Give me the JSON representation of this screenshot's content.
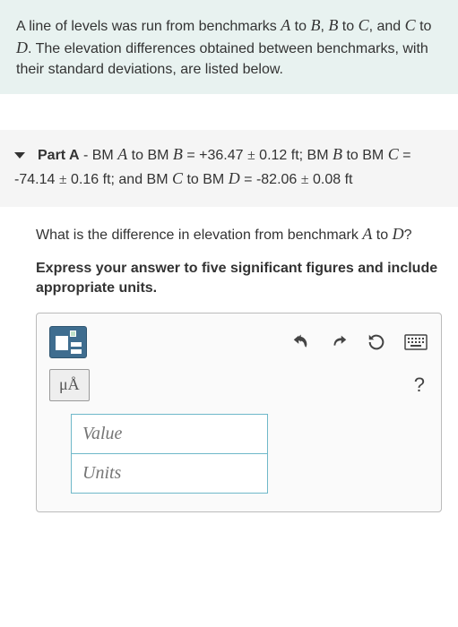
{
  "intro": {
    "text_pre": "A line of levels was run from benchmarks ",
    "A": "A",
    "to1": " to ",
    "B": "B",
    "comma1": ", ",
    "B2": "B",
    "to2": " to ",
    "C": "C",
    "comma2": ", and ",
    "C2": "C",
    "to3": " to ",
    "D": "D",
    "text_post": ". The elevation differences obtained between benchmarks, with their standard deviations, are listed below."
  },
  "part": {
    "label": "Part A",
    "dash": " - ",
    "seg1_pre": "BM ",
    "seg1_A": "A",
    "seg1_mid": " to BM ",
    "seg1_B": "B",
    "seg1_eq": " = +36.47 ",
    "pm": "±",
    "seg1_err": " 0.12 ft",
    "seg1_sep": "; BM ",
    "seg2_B": "B",
    "seg2_mid": " to BM ",
    "seg2_C": "C",
    "seg2_eq": " = -74.14 ",
    "seg2_err": " 0.16 ft",
    "seg2_sep": "; and BM ",
    "seg3_C": "C",
    "seg3_mid": " to BM ",
    "seg3_D": "D",
    "seg3_eq": " = -82.06 ",
    "seg3_err": " 0.08 ft"
  },
  "question": {
    "text_pre": "What is the difference in elevation from benchmark ",
    "A": "A",
    "text_mid": " to ",
    "D": "D",
    "text_post": "?",
    "instruct": "Express your answer to five significant figures and include appropriate units."
  },
  "answer": {
    "mu_label": "μÅ",
    "help_label": "?",
    "value_placeholder": "Value",
    "units_placeholder": "Units"
  }
}
